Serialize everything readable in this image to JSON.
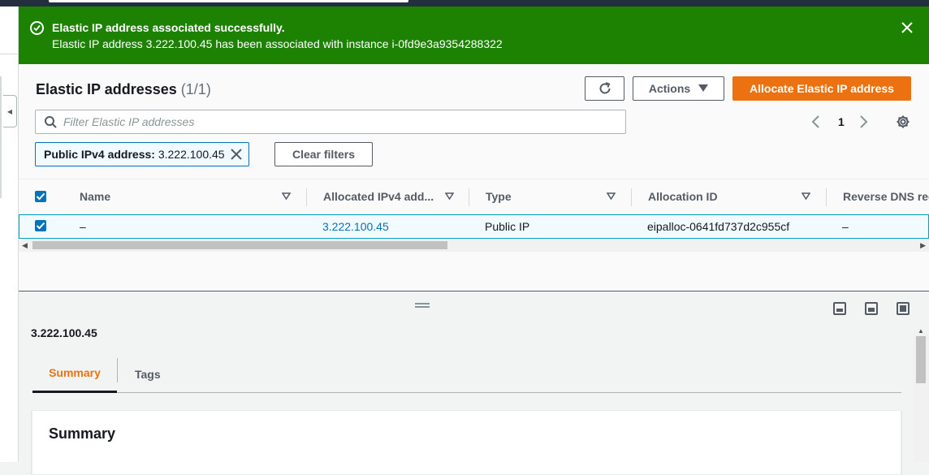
{
  "flash": {
    "title": "Elastic IP address associated successfully.",
    "message": "Elastic IP address 3.222.100.45 has been associated with instance i-0fd9e3a9354288322",
    "color": "#1d8102"
  },
  "header": {
    "title": "Elastic IP addresses",
    "count": "(1/1)",
    "actions_label": "Actions",
    "allocate_label": "Allocate Elastic IP address"
  },
  "search": {
    "placeholder": "Filter Elastic IP addresses",
    "value": ""
  },
  "filter_token": {
    "key": "Public IPv4 address:",
    "value": "3.222.100.45"
  },
  "clear_filters_label": "Clear filters",
  "pagination": {
    "current_page": "1"
  },
  "table": {
    "columns": [
      "Name",
      "Allocated IPv4 add...",
      "Type",
      "Allocation ID",
      "Reverse DNS rec"
    ],
    "rows": [
      {
        "selected": true,
        "name": "–",
        "ip": "3.222.100.45",
        "type": "Public IP",
        "allocation_id": "eipalloc-0641fd737d2c955cf",
        "reverse_dns": "–"
      }
    ]
  },
  "detail": {
    "title": "3.222.100.45",
    "tabs": [
      "Summary",
      "Tags"
    ],
    "active_tab": "Summary",
    "card_title": "Summary"
  },
  "colors": {
    "accent": "#ec7211",
    "link": "#0073bb",
    "selection": "#f1faff"
  }
}
